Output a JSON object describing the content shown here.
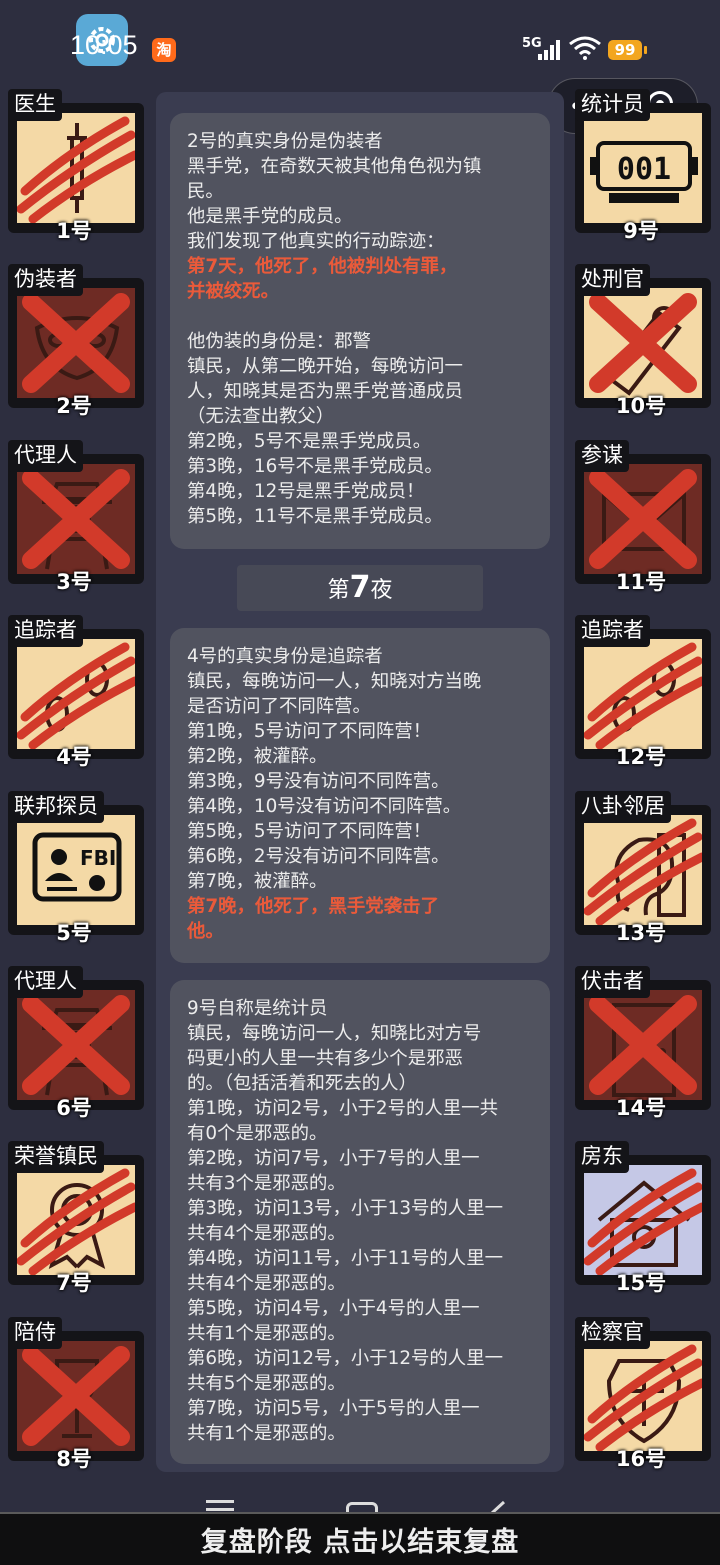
{
  "status_bar": {
    "time": "10:05",
    "network": "5G",
    "battery": "99",
    "taobao_glyph": "淘"
  },
  "capsule": {
    "menu_glyph": "•••"
  },
  "left_cards": [
    {
      "role": "医生",
      "number": "1号",
      "state": "clawed",
      "icon": "syringe-icon",
      "bg": "light"
    },
    {
      "role": "伪装者",
      "number": "2号",
      "state": "crossed",
      "icon": "mask-icon",
      "bg": "dark"
    },
    {
      "role": "代理人",
      "number": "3号",
      "state": "crossed",
      "icon": "agent-icon",
      "bg": "dark"
    },
    {
      "role": "追踪者",
      "number": "4号",
      "state": "clawed",
      "icon": "footprints-icon",
      "bg": "light"
    },
    {
      "role": "联邦探员",
      "number": "5号",
      "state": "alive",
      "icon": "fbi-badge-icon",
      "bg": "light"
    },
    {
      "role": "代理人",
      "number": "6号",
      "state": "crossed",
      "icon": "agent-icon",
      "bg": "dark"
    },
    {
      "role": "荣誉镇民",
      "number": "7号",
      "state": "clawed",
      "icon": "medal-icon",
      "bg": "light"
    },
    {
      "role": "陪侍",
      "number": "8号",
      "state": "crossed",
      "icon": "wine-glass-icon",
      "bg": "dark"
    }
  ],
  "right_cards": [
    {
      "role": "统计员",
      "number": "9号",
      "state": "alive",
      "icon": "counter-icon",
      "bg": "light",
      "counter": "001"
    },
    {
      "role": "处刑官",
      "number": "10号",
      "state": "crossed",
      "icon": "scroll-icon",
      "bg": "light"
    },
    {
      "role": "参谋",
      "number": "11号",
      "state": "crossed",
      "icon": "envelope-icon",
      "bg": "dark"
    },
    {
      "role": "追踪者",
      "number": "12号",
      "state": "clawed",
      "icon": "footprints-icon",
      "bg": "light"
    },
    {
      "role": "八卦邻居",
      "number": "13号",
      "state": "clawed",
      "icon": "ear-icon",
      "bg": "light"
    },
    {
      "role": "伏击者",
      "number": "14号",
      "state": "crossed",
      "icon": "door-icon",
      "bg": "dark"
    },
    {
      "role": "房东",
      "number": "15号",
      "state": "clawed",
      "icon": "house-icon",
      "bg": "blue"
    },
    {
      "role": "检察官",
      "number": "16号",
      "state": "clawed",
      "icon": "scales-icon",
      "bg": "light"
    }
  ],
  "log": {
    "bubble1": [
      {
        "text": "2号的真实身份是伪装者",
        "style": "normal"
      },
      {
        "text": "黑手党，在奇数天被其他角色视为镇",
        "style": "normal"
      },
      {
        "text": "民。",
        "style": "normal"
      },
      {
        "text": "他是黑手党的成员。",
        "style": "normal"
      },
      {
        "text": "我们发现了他真实的行动踪迹：",
        "style": "normal"
      },
      {
        "text": "第7天，他死了，他被判处有罪，",
        "style": "red"
      },
      {
        "text": "并被绞死。",
        "style": "red"
      },
      {
        "text": "",
        "style": "gap"
      },
      {
        "text": "他伪装的身份是：郡警",
        "style": "normal"
      },
      {
        "text": "镇民，从第二晚开始，每晚访问一",
        "style": "normal"
      },
      {
        "text": "人，知晓其是否为黑手党普通成员",
        "style": "normal"
      },
      {
        "text": "（无法查出教父）",
        "style": "normal"
      },
      {
        "text": "第2晚，5号不是黑手党成员。",
        "style": "normal"
      },
      {
        "text": "第3晚，16号不是黑手党成员。",
        "style": "normal"
      },
      {
        "text": "第4晚，12号是黑手党成员！",
        "style": "normal"
      },
      {
        "text": "第5晚，11号不是黑手党成员。",
        "style": "normal"
      }
    ],
    "night_header": {
      "prefix": "第",
      "number": "7",
      "suffix": "夜"
    },
    "bubble2": [
      {
        "text": "4号的真实身份是追踪者",
        "style": "normal"
      },
      {
        "text": "镇民，每晚访问一人，知晓对方当晚",
        "style": "normal"
      },
      {
        "text": "是否访问了不同阵营。",
        "style": "normal"
      },
      {
        "text": "第1晚，5号访问了不同阵营！",
        "style": "normal"
      },
      {
        "text": "第2晚，被灌醉。",
        "style": "normal"
      },
      {
        "text": "第3晚，9号没有访问不同阵营。",
        "style": "normal"
      },
      {
        "text": "第4晚，10号没有访问不同阵营。",
        "style": "normal"
      },
      {
        "text": "第5晚，5号访问了不同阵营！",
        "style": "normal"
      },
      {
        "text": "第6晚，2号没有访问不同阵营。",
        "style": "normal"
      },
      {
        "text": "第7晚，被灌醉。",
        "style": "normal"
      },
      {
        "text": "第7晚，他死了，黑手党袭击了",
        "style": "red"
      },
      {
        "text": "他。",
        "style": "red"
      }
    ],
    "bubble3": [
      {
        "text": "9号自称是统计员",
        "style": "normal"
      },
      {
        "text": "镇民，每晚访问一人，知晓比对方号",
        "style": "normal"
      },
      {
        "text": "码更小的人里一共有多少个是邪恶",
        "style": "normal"
      },
      {
        "text": "的。（包括活着和死去的人）",
        "style": "normal"
      },
      {
        "text": "第1晚，访问2号，小于2号的人里一共",
        "style": "normal"
      },
      {
        "text": "有0个是邪恶的。",
        "style": "normal"
      },
      {
        "text": "第2晚，访问7号，小于7号的人里一",
        "style": "normal"
      },
      {
        "text": "共有3个是邪恶的。",
        "style": "normal"
      },
      {
        "text": "第3晚，访问13号，小于13号的人里一",
        "style": "normal"
      },
      {
        "text": "共有4个是邪恶的。",
        "style": "normal"
      },
      {
        "text": "第4晚，访问11号，小于11号的人里一",
        "style": "normal"
      },
      {
        "text": "共有4个是邪恶的。",
        "style": "normal"
      },
      {
        "text": "第5晚，访问4号，小于4号的人里一",
        "style": "normal"
      },
      {
        "text": "共有1个是邪恶的。",
        "style": "normal"
      },
      {
        "text": "第6晚，访问12号，小于12号的人里一",
        "style": "normal"
      },
      {
        "text": "共有5个是邪恶的。",
        "style": "normal"
      },
      {
        "text": "第7晚，访问5号，小于5号的人里一",
        "style": "normal"
      },
      {
        "text": "共有1个是邪恶的。",
        "style": "normal"
      }
    ]
  },
  "bottom_bar": {
    "label": "复盘阶段 点击以结束复盘"
  },
  "colors": {
    "background": "#2d2e3f",
    "card_light": "#f4d9a6",
    "card_dark": "#6e2b24",
    "card_blue": "#c5c8e6",
    "claw": "#d23a2a",
    "death_text": "#ea5a3a",
    "bubble": "#51535f"
  }
}
